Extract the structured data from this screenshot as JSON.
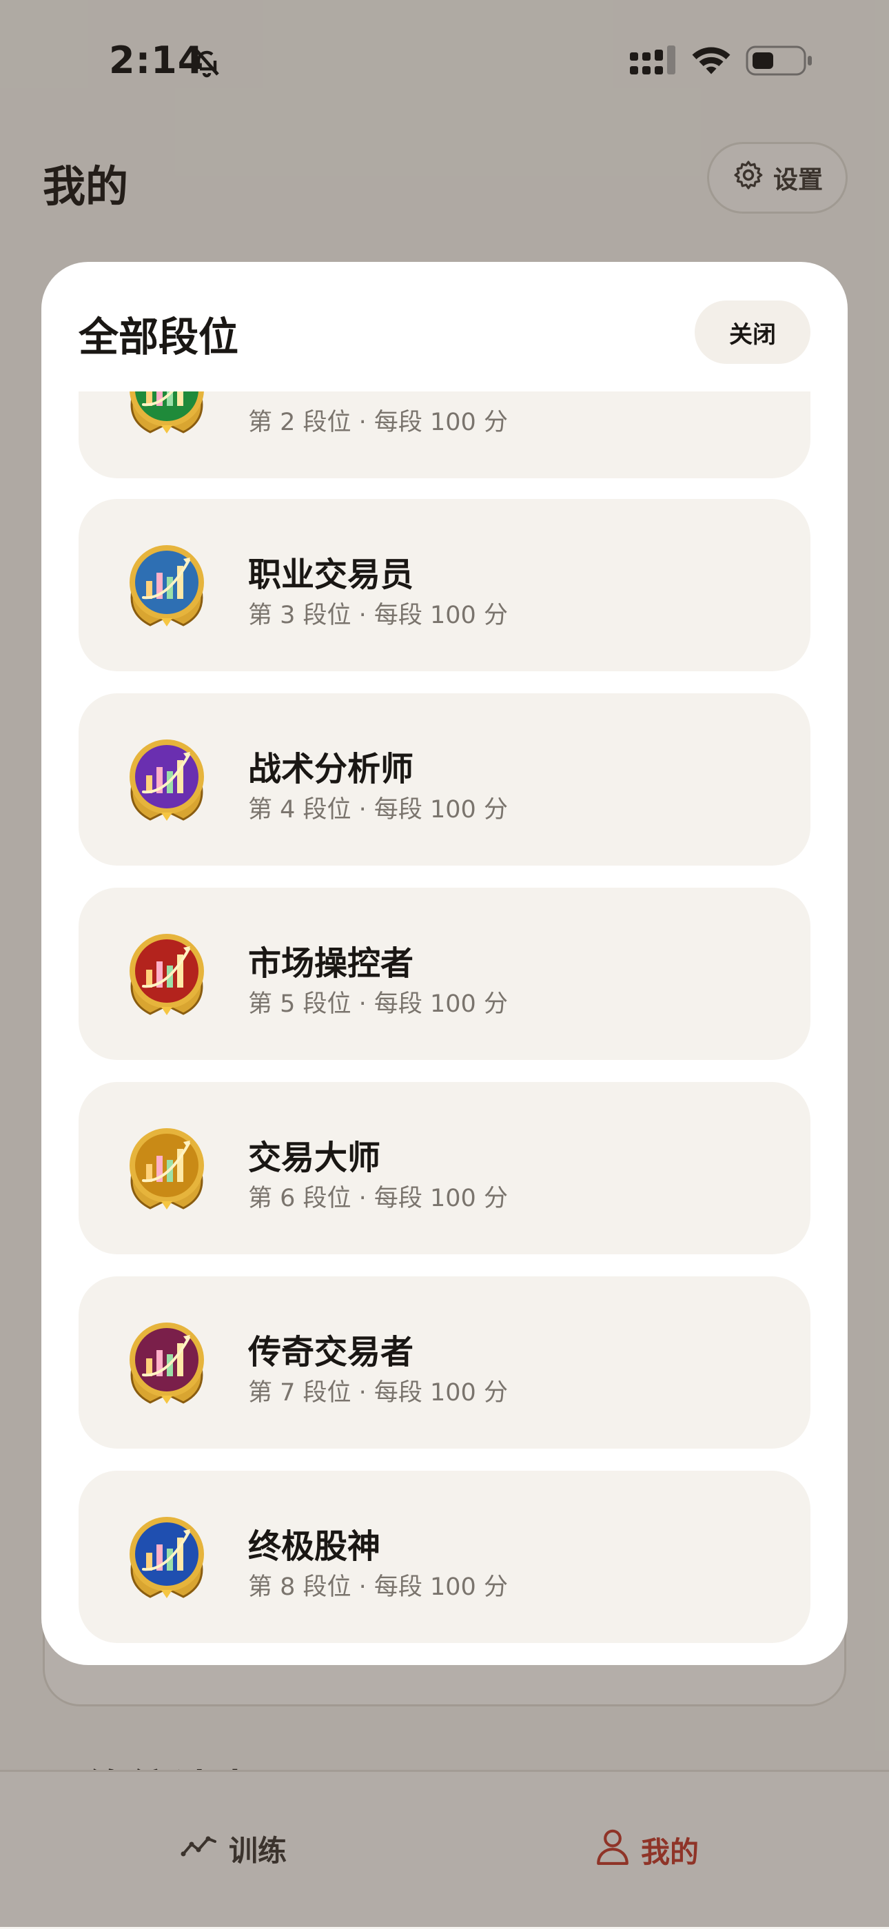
{
  "status_bar": {
    "time": "2:14"
  },
  "header": {
    "title": "我的",
    "settings_label": "设置"
  },
  "modal": {
    "title": "全部段位",
    "close_label": "关闭",
    "ranks": [
      {
        "name": "",
        "subtitle": "第 2 段位 · 每段 100 分",
        "badge_color": "#1f8a3a"
      },
      {
        "name": "职业交易员",
        "subtitle": "第 3 段位 · 每段 100 分",
        "badge_color": "#2e6fb3"
      },
      {
        "name": "战术分析师",
        "subtitle": "第 4 段位 · 每段 100 分",
        "badge_color": "#6a2fb0"
      },
      {
        "name": "市场操控者",
        "subtitle": "第 5 段位 · 每段 100 分",
        "badge_color": "#b3231d"
      },
      {
        "name": "交易大师",
        "subtitle": "第 6 段位 · 每段 100 分",
        "badge_color": "#c98a16"
      },
      {
        "name": "传奇交易者",
        "subtitle": "第 7 段位 · 每段 100 分",
        "badge_color": "#7a1f4a"
      },
      {
        "name": "终极股神",
        "subtitle": "第 8 段位 · 每段 100 分",
        "badge_color": "#1f4fb0"
      }
    ]
  },
  "background": {
    "section_heading": "训练统计中心"
  },
  "tabbar": {
    "tabs": [
      {
        "label": "训练",
        "icon": "line-chart-icon",
        "active": false
      },
      {
        "label": "我的",
        "icon": "user-icon",
        "active": true
      }
    ]
  },
  "colors": {
    "accent": "#c0392b",
    "card_bg": "#f5f2ed",
    "page_bg": "#f3f0eb"
  }
}
